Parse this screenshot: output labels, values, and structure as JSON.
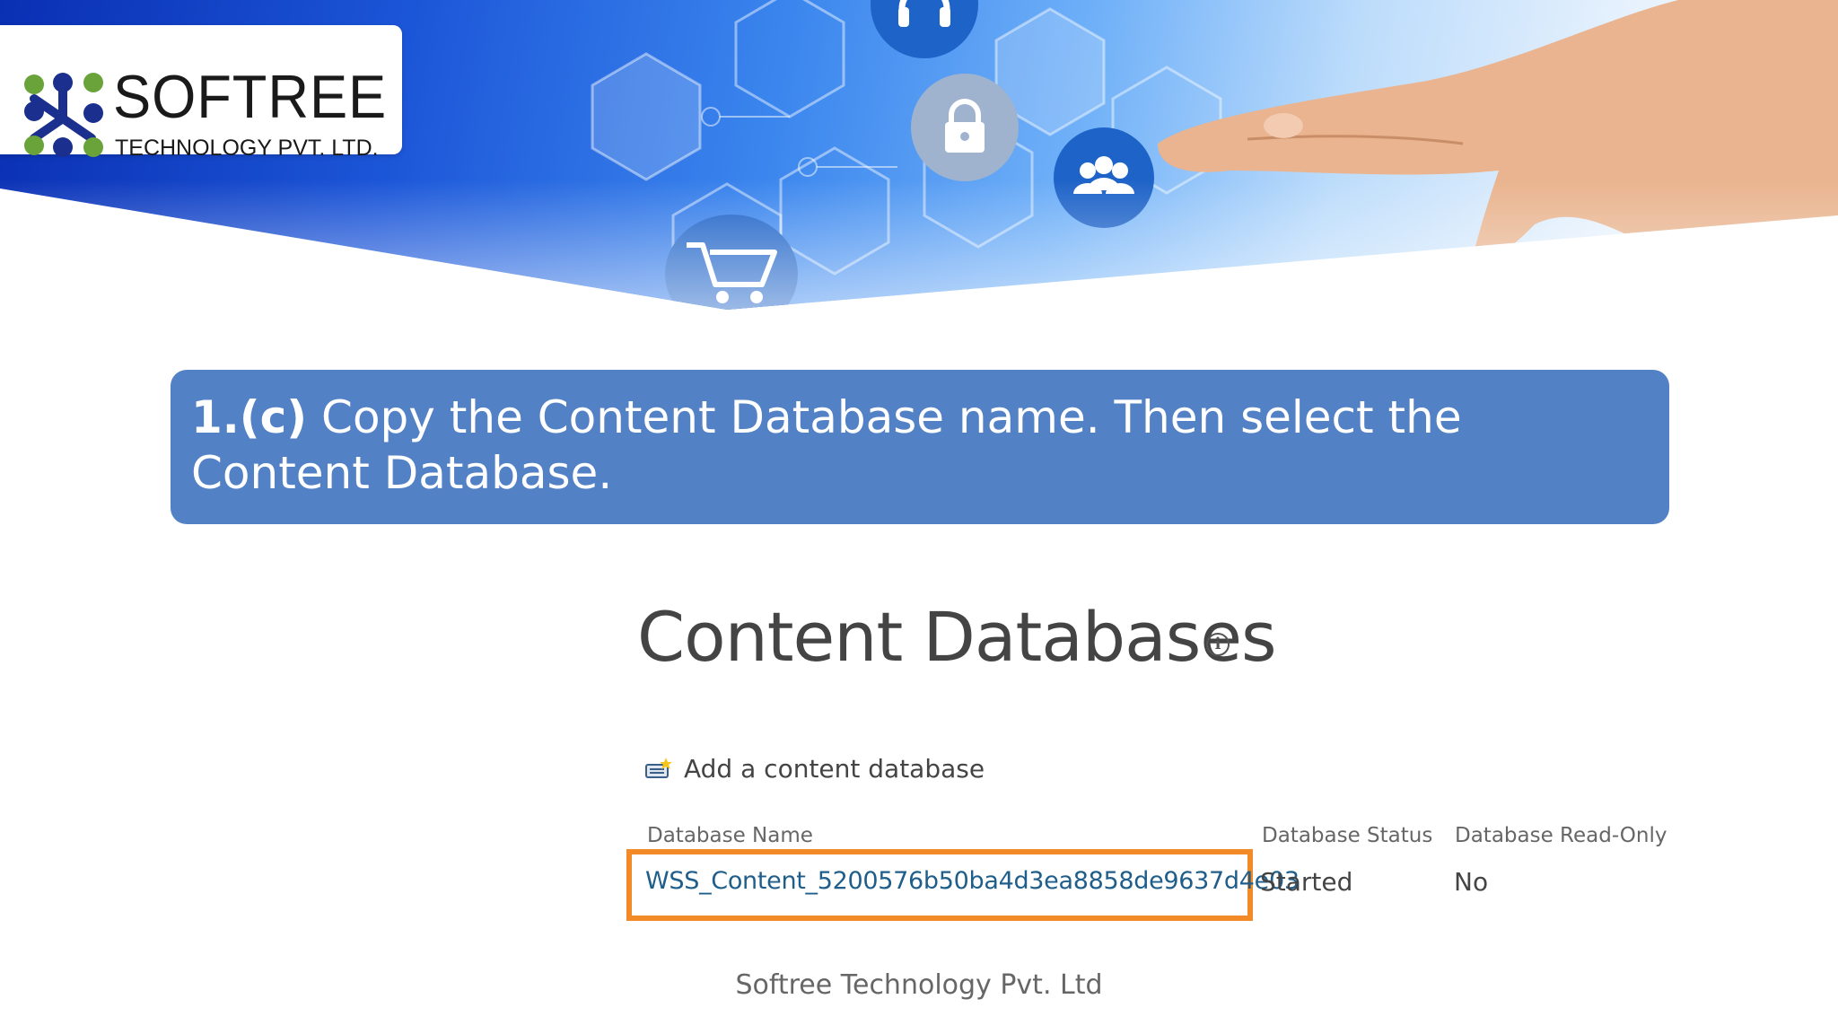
{
  "logo": {
    "name": "SOFTREE",
    "subtitle": "TECHNOLOGY PVT. LTD."
  },
  "banner_icons": [
    "headset-icon",
    "lock-icon",
    "users-icon",
    "shopping-cart-icon"
  ],
  "instruction": {
    "step": "1.(c)",
    "text": "Copy the Content Database name. Then select the Content Database."
  },
  "page": {
    "title": "Content Databases",
    "add_database_label": "Add a content database"
  },
  "table": {
    "columns": [
      "Database Name",
      "Database Status",
      "Database Read-Only"
    ],
    "rows": [
      {
        "name": "WSS_Content_5200576b50ba4d3ea8858de9637d4e03",
        "status": "Started",
        "read_only": "No"
      }
    ]
  },
  "footer": "Softree Technology Pvt. Ltd",
  "colors": {
    "instruction_bg": "#5381c6",
    "highlight_border": "#f28a28",
    "link": "#1f5e8a",
    "logo_blue": "#1b2f8f",
    "logo_green": "#6aa33a"
  }
}
